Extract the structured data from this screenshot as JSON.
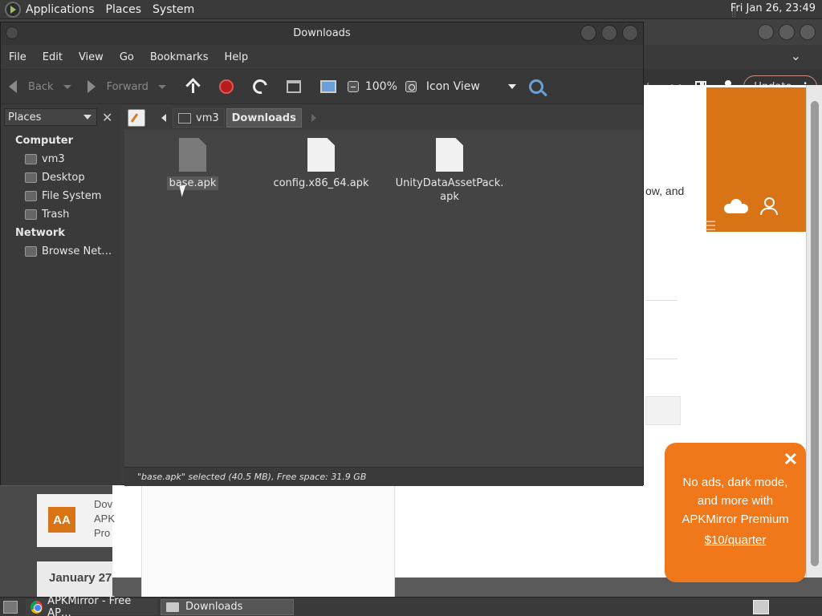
{
  "top_panel": {
    "menus": [
      "Applications",
      "Places",
      "System"
    ],
    "clock": "Fri Jan 26, 23:49"
  },
  "browser": {
    "update_label": "Update",
    "page_text_fragment": "ow, and",
    "card": {
      "logo": "AA",
      "lines": [
        "Dov",
        "APK",
        "Pro"
      ]
    },
    "date_heading": "January 27",
    "promo": {
      "lines": [
        "No ads, dark mode,",
        "and more with",
        "APKMirror Premium"
      ],
      "price": "$10/quarter",
      "close": "✕"
    }
  },
  "file_manager": {
    "title": "Downloads",
    "menu": [
      "File",
      "Edit",
      "View",
      "Go",
      "Bookmarks",
      "Help"
    ],
    "toolbar": {
      "back": "Back",
      "forward": "Forward",
      "zoom": "100%",
      "view_mode": "Icon View"
    },
    "sidebar": {
      "selector": "Places",
      "sections": [
        {
          "title": "Computer",
          "items": [
            "vm3",
            "Desktop",
            "File System",
            "Trash"
          ]
        },
        {
          "title": "Network",
          "items": [
            "Browse Net…"
          ]
        }
      ]
    },
    "path": [
      "vm3",
      "Downloads"
    ],
    "files": [
      {
        "name": "base.apk",
        "selected": true
      },
      {
        "name": "config.x86_64.apk",
        "selected": false
      },
      {
        "name_line1": "UnityDataAssetPack.",
        "name_line2": "apk",
        "selected": false
      }
    ],
    "status": "\"base.apk\" selected (40.5 MB), Free space: 31.9 GB"
  },
  "taskbar": {
    "tasks": [
      "APKMirror - Free AP…",
      "Downloads"
    ]
  }
}
